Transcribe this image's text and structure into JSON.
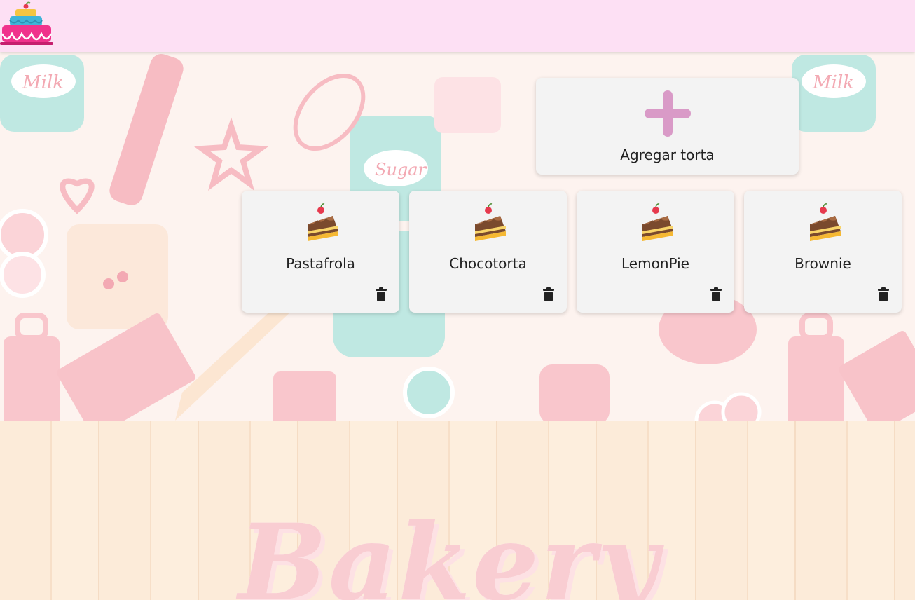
{
  "header": {
    "logo_icon": "layered-cake-logo-icon"
  },
  "background": {
    "watermark_text": "Bakery"
  },
  "add_card": {
    "label": "Agregar torta",
    "icon": "plus-icon",
    "icon_color": "#d99ac7"
  },
  "cakes": [
    {
      "name": "Pastafrola",
      "icon": "cake-slice-icon",
      "action_icon": "trash-icon"
    },
    {
      "name": "Chocotorta",
      "icon": "cake-slice-icon",
      "action_icon": "trash-icon"
    },
    {
      "name": "LemonPie",
      "icon": "cake-slice-icon",
      "action_icon": "trash-icon"
    },
    {
      "name": "Brownie",
      "icon": "cake-slice-icon",
      "action_icon": "trash-icon"
    }
  ],
  "colors": {
    "header_bg": "#fde0f4",
    "card_bg": "#f3f3f3",
    "background_pink": "#f9cdd2",
    "background_mint": "#bfe8e2"
  }
}
